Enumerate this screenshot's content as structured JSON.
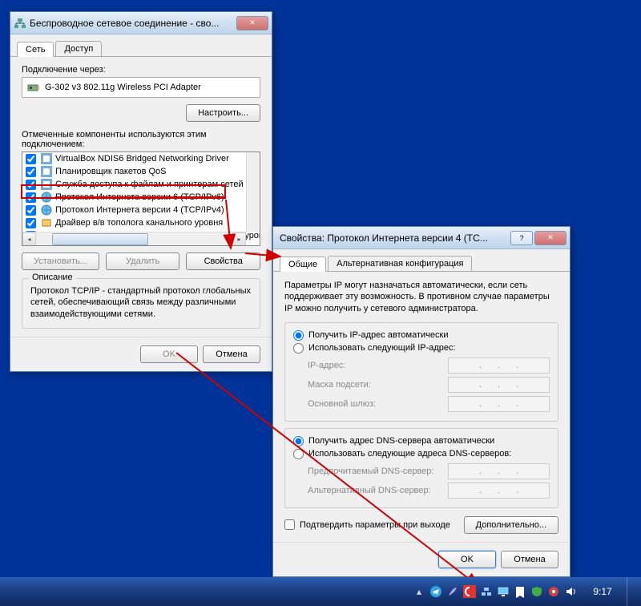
{
  "window1": {
    "title": "Беспроводное сетевое соединение - сво...",
    "tabs": [
      "Сеть",
      "Доступ"
    ],
    "connect_label": "Подключение через:",
    "adapter": "G-302 v3 802.11g Wireless PCI Adapter",
    "configure_btn": "Настроить...",
    "components_label": "Отмеченные компоненты используются этим подключением:",
    "items": [
      "VirtualBox NDIS6 Bridged Networking Driver",
      "Планировщик пакетов QoS",
      "Служба доступа к файлам и принтерам сетей Micro",
      "Протокол Интернета версии 6 (TCP/IPv6)",
      "Протокол Интернета версии 4 (TCP/IPv4)",
      "Драйвер в/в тополога канального уровня",
      "Ответчик обнаружения топологии канального уров"
    ],
    "install_btn": "Установить...",
    "uninstall_btn": "Удалить",
    "properties_btn": "Свойства",
    "desc_title": "Описание",
    "desc_text": "Протокол TCP/IP - стандартный протокол глобальных сетей, обеспечивающий связь между различными взаимодействующими сетями.",
    "ok": "OK",
    "cancel": "Отмена"
  },
  "window2": {
    "title": "Свойства: Протокол Интернета версии 4 (TC...",
    "tabs": [
      "Общие",
      "Альтернативная конфигурация"
    ],
    "info": "Параметры IP могут назначаться автоматически, если сеть поддерживает эту возможность. В противном случае параметры IP можно получить у сетевого администратора.",
    "r1": "Получить IP-адрес автоматически",
    "r2": "Использовать следующий IP-адрес:",
    "ip_label": "IP-адрес:",
    "mask_label": "Маска подсети:",
    "gw_label": "Основной шлюз:",
    "r3": "Получить адрес DNS-сервера автоматически",
    "r4": "Использовать следующие адреса DNS-серверов:",
    "dns1_label": "Предпочитаемый DNS-сервер:",
    "dns2_label": "Альтернативный DNS-сервер:",
    "confirm_exit": "Подтвердить параметры при выходе",
    "advanced": "Дополнительно...",
    "ok": "OK",
    "cancel": "Отмена"
  },
  "taskbar": {
    "time": "9:17"
  }
}
